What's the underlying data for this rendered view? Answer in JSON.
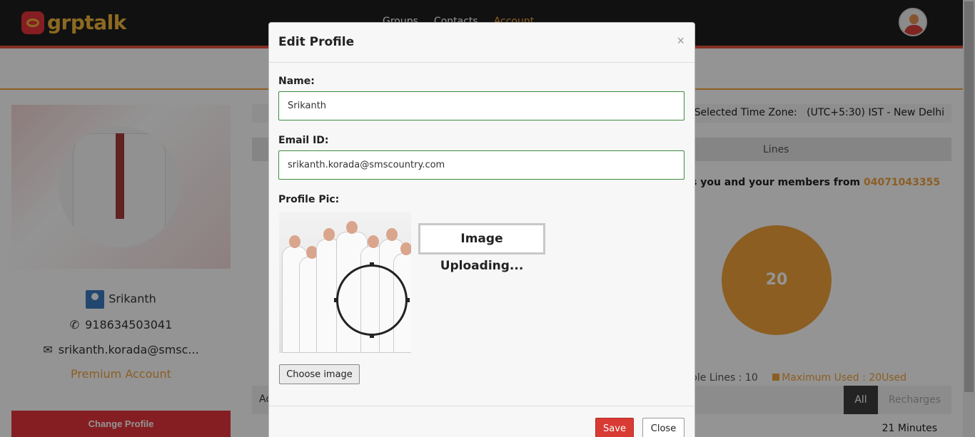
{
  "app": {
    "logo_text": "grptalk"
  },
  "nav": {
    "groups": "Groups",
    "contacts": "Contacts",
    "account": "Account"
  },
  "profile": {
    "name": "Srikanth",
    "phone": "918634503041",
    "email": "srikanth.korada@smsc...",
    "account_type": "Premium Account",
    "change_profile_label": "Change Profile"
  },
  "timezone": {
    "label": "Selected Time Zone:",
    "value": "(UTC+5:30) IST - New Delhi"
  },
  "lines": {
    "header": "Lines",
    "calls_text": "s you and your members from",
    "calls_number": "04071043355",
    "pie_value": "20",
    "legend_available": "ble Lines : 10",
    "legend_max": "Maximum Used : 20Used"
  },
  "activity": {
    "header_partial": "Ac",
    "tab_all": "All",
    "tab_recharges": "Recharges",
    "row_duration": "21 Minutes"
  },
  "modal": {
    "title": "Edit Profile",
    "close_x": "×",
    "name_label": "Name:",
    "name_value": "Srikanth",
    "email_label": "Email ID:",
    "email_value": "srikanth.korada@smscountry.com",
    "profile_pic_label": "Profile Pic:",
    "uploading_text": "Image Uploading...",
    "choose_image_label": "Choose image",
    "save_label": "Save",
    "close_label": "Close"
  },
  "colors": {
    "accent": "#f1a33c",
    "brand_red": "#e5353c",
    "topbar": "#1e1e1e"
  }
}
